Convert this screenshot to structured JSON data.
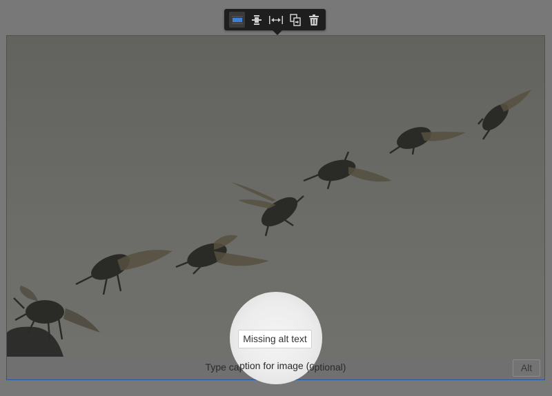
{
  "toolbar": {
    "buttons": [
      {
        "icon": "align-wide-icon",
        "active": true
      },
      {
        "icon": "align-center-icon",
        "active": false
      },
      {
        "icon": "full-width-icon",
        "active": false
      },
      {
        "icon": "replace-image-icon",
        "active": false
      },
      {
        "icon": "trash-icon",
        "active": false
      }
    ]
  },
  "image": {
    "subject": "beetle-flight-sequence-photo"
  },
  "caption": {
    "placeholder": "Type caption for image (optional)"
  },
  "alt_button": {
    "label": "Alt"
  },
  "missing_alt": {
    "label": "Missing alt text"
  },
  "colors": {
    "selection_border": "#2057a8",
    "toolbar_bg": "#1e1e1e",
    "active_icon": "#4a90e2"
  }
}
